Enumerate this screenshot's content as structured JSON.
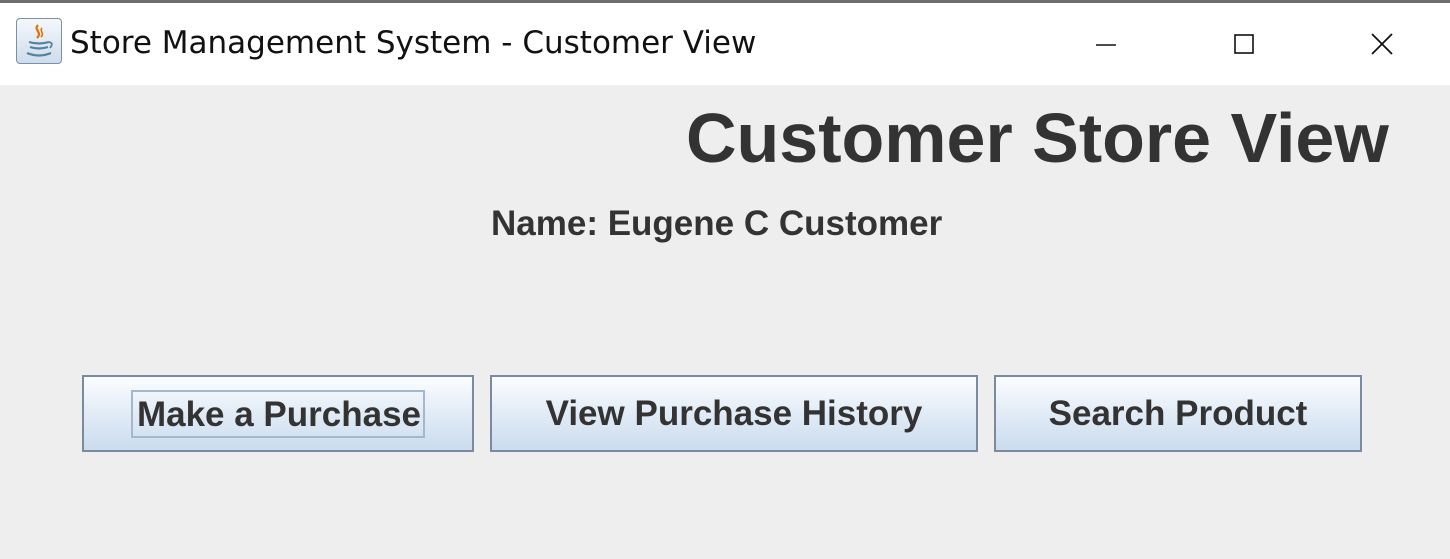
{
  "window": {
    "title": "Store Management System - Customer View",
    "icon": "java-coffee-cup-icon",
    "controls": [
      "minimize-icon",
      "maximize-icon",
      "close-icon"
    ]
  },
  "main": {
    "heading": "Customer Store View",
    "name_line": "Name: Eugene C Customer"
  },
  "buttons": {
    "make_purchase": "Make a Purchase",
    "view_history": "View Purchase History",
    "search_product": "Search Product"
  },
  "colors": {
    "background": "#eeeeee",
    "text": "#333333",
    "button_border": "#7a8aa0",
    "focus_ring": "#a3b8cc"
  }
}
